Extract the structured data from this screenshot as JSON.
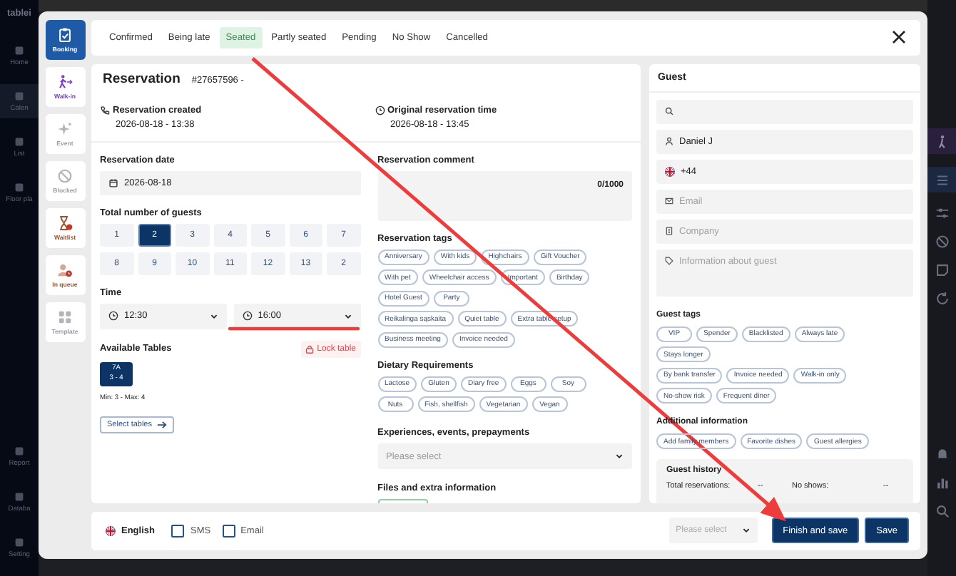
{
  "app_nav": {
    "logo": "tablei",
    "items": [
      {
        "label": "Home",
        "selected": false
      },
      {
        "label": "Calen",
        "selected": true
      },
      {
        "label": "List",
        "selected": false
      },
      {
        "label": "Floor pla",
        "selected": false
      },
      {
        "label": "Report",
        "selected": false
      },
      {
        "label": "Databa",
        "selected": false
      },
      {
        "label": "Setting",
        "selected": false
      }
    ]
  },
  "rail": [
    {
      "label": "Booking",
      "kind": "booking",
      "selected": true,
      "disabled": false
    },
    {
      "label": "Walk-in",
      "kind": "walkin",
      "selected": false,
      "disabled": false
    },
    {
      "label": "Event",
      "kind": "event",
      "selected": false,
      "disabled": true
    },
    {
      "label": "Blocked",
      "kind": "blocked",
      "selected": false,
      "disabled": true
    },
    {
      "label": "Waitlist",
      "kind": "waitlist",
      "selected": false,
      "disabled": false
    },
    {
      "label": "In queue",
      "kind": "queue",
      "selected": false,
      "disabled": false
    },
    {
      "label": "Template",
      "kind": "template",
      "selected": false,
      "disabled": true
    }
  ],
  "tabs": [
    {
      "label": "Confirmed",
      "selected": false
    },
    {
      "label": "Being late",
      "selected": false
    },
    {
      "label": "Seated",
      "selected": true
    },
    {
      "label": "Partly seated",
      "selected": false
    },
    {
      "label": "Pending",
      "selected": false
    },
    {
      "label": "No Show",
      "selected": false
    },
    {
      "label": "Cancelled",
      "selected": false
    }
  ],
  "reservation": {
    "title": "Reservation",
    "number": "#27657596 -",
    "created_label": "Reservation created",
    "created": "2026-08-18 - 13:38",
    "original_label": "Original reservation time",
    "original": "2026-08-18 - 13:45",
    "date_label": "Reservation date",
    "date": "2026-08-18",
    "guests_label": "Total number of guests",
    "guest_counts": [
      {
        "label": "1",
        "selected": false
      },
      {
        "label": "2",
        "selected": true
      },
      {
        "label": "3",
        "selected": false
      },
      {
        "label": "4",
        "selected": false
      },
      {
        "label": "5",
        "selected": false
      },
      {
        "label": "6",
        "selected": false
      },
      {
        "label": "7",
        "selected": false
      },
      {
        "label": "8",
        "selected": false
      },
      {
        "label": "9",
        "selected": false
      },
      {
        "label": "10",
        "selected": false
      },
      {
        "label": "11",
        "selected": false
      },
      {
        "label": "12",
        "selected": false
      },
      {
        "label": "13",
        "selected": false
      },
      {
        "label": "2",
        "selected": false
      }
    ],
    "time_label": "Time",
    "start_time": "12:30",
    "end_time": "16:00",
    "tables_label": "Available Tables",
    "lock_label": "Lock table",
    "tables": [
      {
        "name": "7A",
        "capacity": "3 - 4",
        "selected": true
      }
    ],
    "min_max": "Min: 3 - Max: 4",
    "select_tables": "Select tables",
    "comment_label": "Reservation comment",
    "comment_counter": "0/1000",
    "tags_label": "Reservation tags",
    "tag_rows": [
      [
        "Anniversary",
        "With kids",
        "Highchairs",
        "Gift Voucher"
      ],
      [
        "With pet",
        "Wheelchair access",
        "Important",
        "Birthday"
      ],
      [
        "Hotel Guest",
        "Party"
      ],
      [
        "Reikalinga sąskaita",
        "Quiet table",
        "Extra table setup"
      ],
      [
        "Business meeting",
        "Invoice needed"
      ]
    ],
    "dietary_label": "Dietary Requirements",
    "dietary_rows": [
      [
        "Lactose",
        "Gluten",
        "Diary free",
        "Eggs",
        "Soy"
      ],
      [
        "Nuts",
        "Fish, shellfish",
        "Vegetarian",
        "Vegan"
      ]
    ],
    "experiences_label": "Experiences, events, prepayments",
    "experiences_placeholder": "Please select",
    "files_label": "Files and extra information"
  },
  "guest": {
    "title": "Guest",
    "name": "Daniel J",
    "phone": "+44",
    "email_placeholder": "Email",
    "company_placeholder": "Company",
    "info_placeholder": "Information about guest",
    "tags_label": "Guest tags",
    "tag_rows": [
      [
        "VIP",
        "Spender",
        "Blacklisted",
        "Always late"
      ],
      [
        "Stays longer"
      ],
      [
        "By bank transfer",
        "Invoice needed",
        "Walk-in only"
      ],
      [
        "No-show risk",
        "Frequent diner"
      ]
    ],
    "additional_label": "Additional information",
    "additional": [
      "Add family members",
      "Favorite dishes",
      "Guest allergies"
    ],
    "history_title": "Guest history",
    "total_label": "Total reservations:",
    "total_value": "--",
    "noshow_label": "No shows:",
    "noshow_value": "--"
  },
  "footer": {
    "language": "English",
    "sms": {
      "label": "SMS",
      "checked": false
    },
    "email": {
      "label": "Email",
      "checked": false
    },
    "status_placeholder": "Please select",
    "finish": "Finish and save",
    "save": "Save"
  }
}
